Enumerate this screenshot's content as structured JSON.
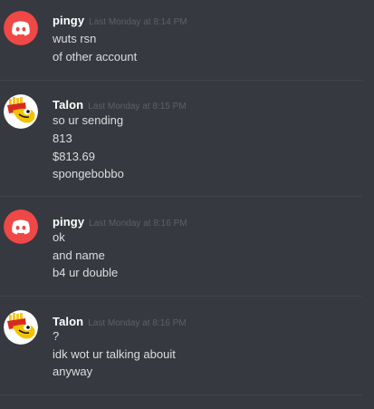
{
  "messages": [
    {
      "username": "pingy",
      "timestamp": "Last Monday at 8:14 PM",
      "avatar_icon": "discord-logo-icon",
      "avatar_color": "#f04747",
      "lines": [
        "wuts rsn",
        "of other account"
      ]
    },
    {
      "username": "Talon",
      "timestamp": "Last Monday at 8:15 PM",
      "avatar_icon": "duck-fries-icon",
      "avatar_color": "#ffffff",
      "lines": [
        "so ur sending",
        "813",
        "$813.69",
        "spongebobbo"
      ]
    },
    {
      "username": "pingy",
      "timestamp": "Last Monday at 8:16 PM",
      "avatar_icon": "discord-logo-icon",
      "avatar_color": "#f04747",
      "lines": [
        "ok",
        "and name",
        "b4 ur double"
      ]
    },
    {
      "username": "Talon",
      "timestamp": "Last Monday at 8:16 PM",
      "avatar_icon": "duck-fries-icon",
      "avatar_color": "#ffffff",
      "lines": [
        "?",
        "idk wot ur talking abouit",
        "anyway"
      ]
    }
  ],
  "colors": {
    "background": "#36393f",
    "username": "#ffffff",
    "timestamp": "#5d6066",
    "message_text": "#dcddde",
    "divider": "#41444a"
  }
}
